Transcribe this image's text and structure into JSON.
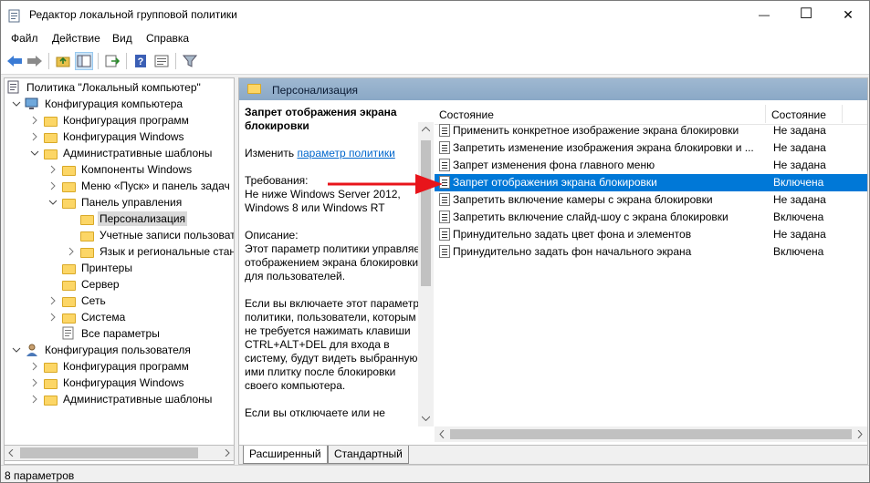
{
  "window": {
    "title": "Редактор локальной групповой политики",
    "minimize_glyph": "—",
    "maximize_glyph": "☐",
    "close_glyph": "✕"
  },
  "menu": [
    "Файл",
    "Действие",
    "Вид",
    "Справка"
  ],
  "toolbar_icons": [
    "back-icon",
    "forward-icon",
    "up-folder-icon",
    "show-hide-tree-icon",
    "export-list-icon",
    "help-icon",
    "properties-icon",
    "filter-icon"
  ],
  "tree": [
    {
      "label": "Политика \"Локальный компьютер\"",
      "level": 0,
      "icon": "computer-icon",
      "expander": "none"
    },
    {
      "label": "Конфигурация компьютера",
      "level": 1,
      "icon": "computer-config-icon",
      "expander": "expanded"
    },
    {
      "label": "Конфигурация программ",
      "level": 2,
      "icon": "folder-icon",
      "expander": "collapsed"
    },
    {
      "label": "Конфигурация Windows",
      "level": 2,
      "icon": "folder-icon",
      "expander": "collapsed"
    },
    {
      "label": "Административные шаблоны",
      "level": 2,
      "icon": "folder-icon",
      "expander": "expanded"
    },
    {
      "label": "Компоненты Windows",
      "level": 3,
      "icon": "folder-icon",
      "expander": "collapsed"
    },
    {
      "label": "Меню «Пуск» и панель задач",
      "level": 3,
      "icon": "folder-icon",
      "expander": "collapsed"
    },
    {
      "label": "Панель управления",
      "level": 3,
      "icon": "folder-icon",
      "expander": "expanded"
    },
    {
      "label": "Персонализация",
      "level": 4,
      "icon": "folder-icon",
      "expander": "none",
      "selected": true
    },
    {
      "label": "Учетные записи пользовате",
      "level": 4,
      "icon": "folder-icon",
      "expander": "none"
    },
    {
      "label": "Язык и региональные станд",
      "level": 4,
      "icon": "folder-icon",
      "expander": "collapsed"
    },
    {
      "label": "Принтеры",
      "level": 3,
      "icon": "folder-icon",
      "expander": "none"
    },
    {
      "label": "Сервер",
      "level": 3,
      "icon": "folder-icon",
      "expander": "none"
    },
    {
      "label": "Сеть",
      "level": 3,
      "icon": "folder-icon",
      "expander": "collapsed"
    },
    {
      "label": "Система",
      "level": 3,
      "icon": "folder-icon",
      "expander": "collapsed"
    },
    {
      "label": "Все параметры",
      "level": 3,
      "icon": "all-settings-icon",
      "expander": "none"
    },
    {
      "label": "Конфигурация пользователя",
      "level": 1,
      "icon": "user-config-icon",
      "expander": "expanded"
    },
    {
      "label": "Конфигурация программ",
      "level": 2,
      "icon": "folder-icon",
      "expander": "collapsed"
    },
    {
      "label": "Конфигурация Windows",
      "level": 2,
      "icon": "folder-icon",
      "expander": "collapsed"
    },
    {
      "label": "Административные шаблоны",
      "level": 2,
      "icon": "folder-icon",
      "expander": "collapsed"
    }
  ],
  "right_header": {
    "title": "Персонализация"
  },
  "description": {
    "heading": "Запрет отображения экрана блокировки",
    "edit_prefix": "Изменить ",
    "edit_link": "параметр политики",
    "requirements_label": "Требования:",
    "requirements_text": "Не ниже Windows Server 2012, Windows 8 или Windows RT",
    "description_label": "Описание:",
    "description_text": "Этот параметр политики управляет отображением экрана блокировки для пользователей.",
    "if_enabled_text": "Если вы включаете этот параметр политики, пользователи, которым не требуется нажимать клавиши CTRL+ALT+DEL для входа в систему, будут видеть выбранную ими плитку после блокировки своего компьютера.",
    "truncated_text": "Если вы отключаете или не"
  },
  "list": {
    "columns": [
      "Состояние",
      "Состояние"
    ],
    "rows": [
      {
        "name": "Применить конкретное изображение экрана блокировки",
        "state": "Не задана"
      },
      {
        "name": "Запретить изменение изображения экрана блокировки и ...",
        "state": "Не задана"
      },
      {
        "name": "Запрет изменения фона главного меню",
        "state": "Не задана"
      },
      {
        "name": "Запрет отображения экрана блокировки",
        "state": "Включена",
        "selected": true
      },
      {
        "name": "Запретить включение камеры с экрана блокировки",
        "state": "Не задана"
      },
      {
        "name": "Запретить включение слайд-шоу с экрана блокировки",
        "state": "Включена"
      },
      {
        "name": "Принудительно задать цвет фона и элементов",
        "state": "Не задана"
      },
      {
        "name": "Принудительно задать фон начального экрана",
        "state": "Включена"
      }
    ]
  },
  "tabs": [
    "Расширенный",
    "Стандартный"
  ],
  "status_bar": "8 параметров",
  "colors": {
    "selection": "#0078d7",
    "arrow": "#e8141b",
    "header": "#93afcb"
  }
}
